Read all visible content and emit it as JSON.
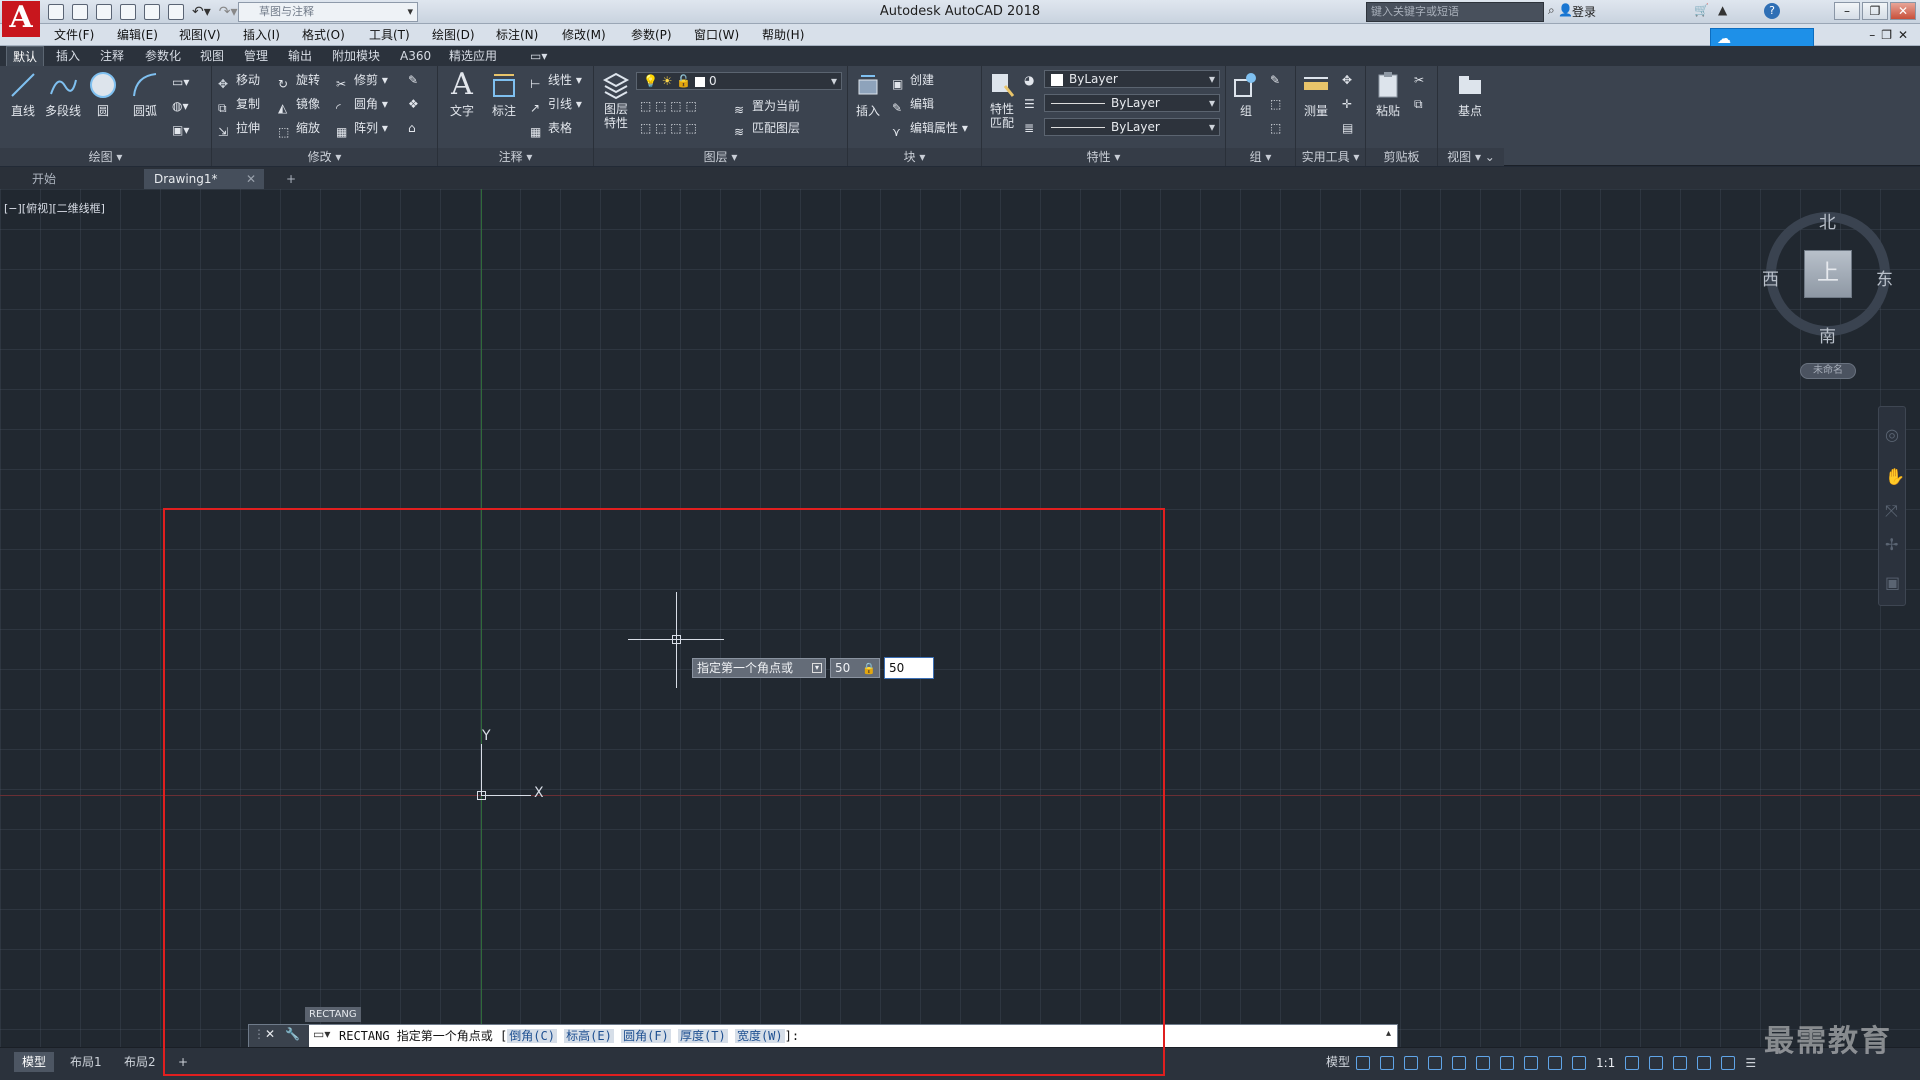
{
  "app": {
    "title": "Autodesk AutoCAD 2018",
    "logo_letter": "A"
  },
  "titlebar": {
    "workspace_placeholder": "草图与注释",
    "search_placeholder": "键入关键字或短语",
    "signin": "登录",
    "help": "?"
  },
  "menus": [
    "文件(F)",
    "编辑(E)",
    "视图(V)",
    "插入(I)",
    "格式(O)",
    "工具(T)",
    "绘图(D)",
    "标注(N)",
    "修改(M)",
    "参数(P)",
    "窗口(W)",
    "帮助(H)"
  ],
  "ribbon_tabs": [
    "默认",
    "插入",
    "注释",
    "参数化",
    "视图",
    "管理",
    "输出",
    "附加模块",
    "A360",
    "精选应用"
  ],
  "ribbon": {
    "draw": {
      "label": "绘图",
      "tools": [
        "直线",
        "多段线",
        "圆",
        "圆弧"
      ]
    },
    "modify": {
      "label": "修改",
      "tools": [
        "移动",
        "旋转",
        "修剪",
        "复制",
        "镜像",
        "圆角",
        "拉伸",
        "缩放",
        "阵列"
      ]
    },
    "annotation": {
      "label": "注释",
      "big": [
        "文字",
        "标注"
      ],
      "small": [
        "线性",
        "引线",
        "表格"
      ]
    },
    "layers": {
      "label": "图层",
      "big": "图层特性",
      "layer_value": "0",
      "small": [
        "置为当前",
        "匹配图层"
      ]
    },
    "block": {
      "label": "块",
      "big": "插入",
      "small": [
        "创建",
        "编辑",
        "编辑属性"
      ]
    },
    "properties": {
      "label": "特性",
      "big": "特性匹配",
      "color": "ByLayer",
      "linetype": "ByLayer",
      "lineweight": "ByLayer"
    },
    "groups": {
      "label": "组",
      "big": "组"
    },
    "utilities": {
      "label": "实用工具",
      "big": "测量"
    },
    "clipboard": {
      "label": "剪贴板",
      "big": "粘贴"
    },
    "view": {
      "label": "视图",
      "big": "基点"
    }
  },
  "file_tabs": [
    "开始",
    "Drawing1*"
  ],
  "viewport_label": "[−][俯视][二维线框]",
  "viewcube": {
    "face": "上",
    "north": "北",
    "south": "南",
    "east": "东",
    "west": "西",
    "wcs": "未命名"
  },
  "ucs": {
    "x": "X",
    "y": "Y"
  },
  "dynamic_input": {
    "prompt": "指定第一个角点或",
    "x_value": "50",
    "y_value": "50"
  },
  "command": {
    "tooltip": "RECTANG",
    "prefix": "RECTANG 指定第一个角点或 [",
    "options": [
      "倒角(C)",
      "标高(E)",
      "圆角(F)",
      "厚度(T)",
      "宽度(W)"
    ],
    "suffix": "]:"
  },
  "status": {
    "tabs": [
      "模型",
      "布局1",
      "布局2"
    ],
    "model_label": "模型",
    "scale": "1:1"
  },
  "watermark": "最需教育",
  "colors": {
    "highlight": "#e01f1f",
    "canvas_bg": "#212830",
    "accent": "#1e90e8"
  }
}
